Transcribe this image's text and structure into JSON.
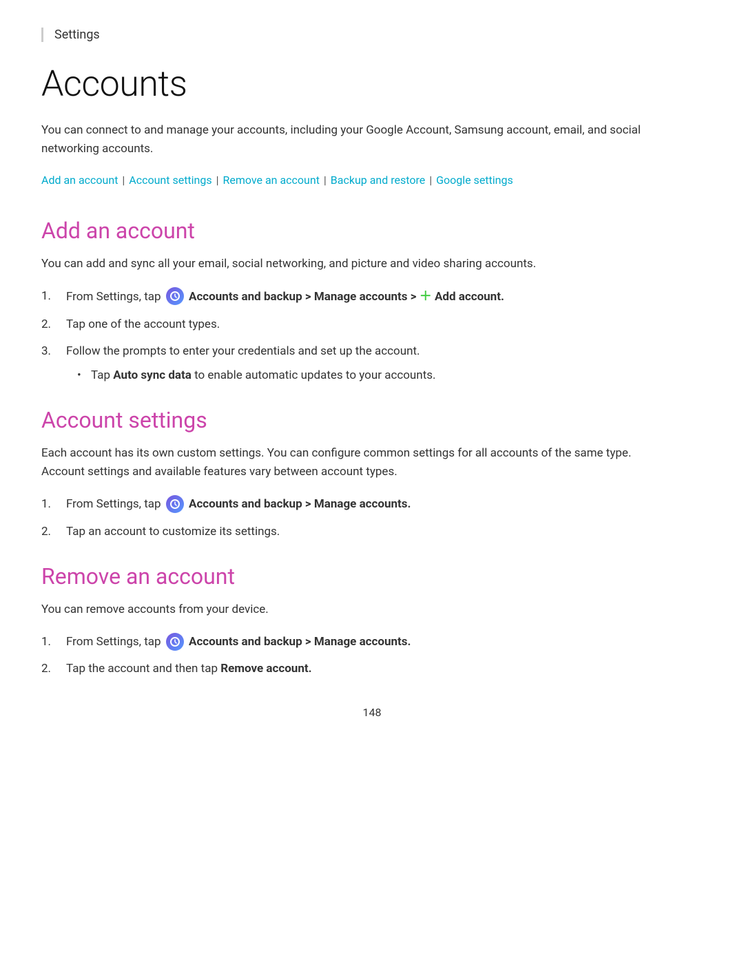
{
  "header": {
    "breadcrumb": "Settings"
  },
  "page": {
    "title": "Accounts",
    "intro": "You can connect to and manage your accounts, including your Google Account, Samsung account, email, and social networking accounts.",
    "page_number": "148"
  },
  "nav_links": {
    "add_account": "Add an account",
    "account_settings": "Account settings",
    "remove_account": "Remove an account",
    "backup_restore": "Backup and restore",
    "google_settings": "Google settings",
    "separator": "|"
  },
  "sections": {
    "add_account": {
      "title": "Add an account",
      "intro": "You can add and sync all your email, social networking, and picture and video sharing accounts.",
      "steps": [
        {
          "num": "1.",
          "text_before": "From Settings, tap",
          "icon": true,
          "text_bold": "Accounts and backup > Manage accounts >",
          "plus": true,
          "text_bold2": "Add account."
        },
        {
          "num": "2.",
          "text": "Tap one of the account types."
        },
        {
          "num": "3.",
          "text": "Follow the prompts to enter your credentials and set up the account."
        }
      ],
      "bullet": {
        "text_before": "Tap",
        "bold": "Auto sync data",
        "text_after": "to enable automatic updates to your accounts."
      }
    },
    "account_settings": {
      "title": "Account settings",
      "intro": "Each account has its own custom settings. You can configure common settings for all accounts of the same type. Account settings and available features vary between account types.",
      "steps": [
        {
          "num": "1.",
          "text_before": "From Settings, tap",
          "icon": true,
          "text_bold": "Accounts and backup > Manage accounts."
        },
        {
          "num": "2.",
          "text": "Tap an account to customize its settings."
        }
      ]
    },
    "remove_account": {
      "title": "Remove an account",
      "intro": "You can remove accounts from your device.",
      "steps": [
        {
          "num": "1.",
          "text_before": "From Settings, tap",
          "icon": true,
          "text_bold": "Accounts and backup > Manage accounts."
        },
        {
          "num": "2.",
          "text_before": "Tap the account and then tap",
          "bold": "Remove account."
        }
      ]
    }
  }
}
